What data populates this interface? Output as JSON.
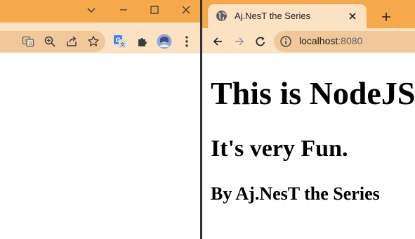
{
  "colors": {
    "titlebar": "#f6a94a",
    "toolbar": "#fbe2c3",
    "omnibox": "#f1c89a",
    "divider": "#333333",
    "icon": "#3c3c3c"
  },
  "left_window": {
    "controls": [
      "chevron-down-icon",
      "minimize-icon",
      "maximize-icon",
      "close-icon"
    ],
    "toolbar_icons": [
      "translate-icon",
      "zoom-icon",
      "share-icon",
      "bookmark-star-icon",
      "google-translate-extension-icon",
      "extensions-puzzle-icon",
      "profile-avatar",
      "kebab-menu-icon"
    ]
  },
  "right_window": {
    "tab": {
      "title": "Aj.NesT the Series",
      "favicon": "globe-icon"
    },
    "toolbar": {
      "nav_icons": [
        "back-arrow-icon",
        "forward-arrow-icon",
        "reload-icon"
      ],
      "url_host": "localhost",
      "url_port": ":8080"
    },
    "page": {
      "h1": "This is NodeJS",
      "h2": "It's very Fun.",
      "h3": "By Aj.NesT the Series"
    }
  }
}
